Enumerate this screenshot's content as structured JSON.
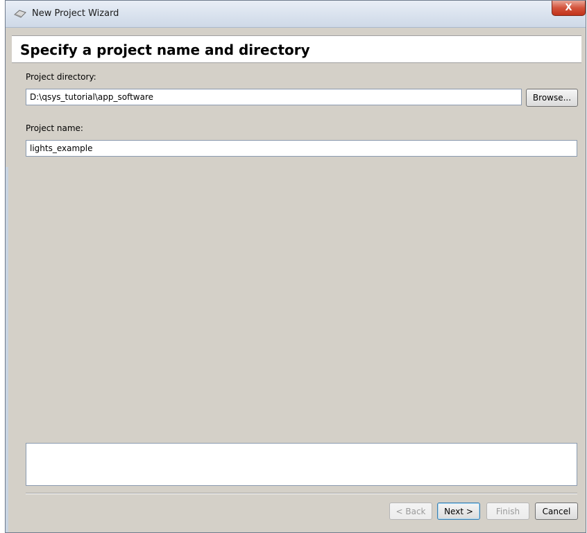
{
  "window": {
    "title": "New Project Wizard",
    "close_glyph": "X"
  },
  "header": {
    "title": "Specify a project name and directory"
  },
  "form": {
    "directory_label": "Project directory:",
    "directory_value": "D:\\qsys_tutorial\\app_software",
    "browse_label": "Browse...",
    "name_label": "Project name:",
    "name_value": "lights_example"
  },
  "message": {
    "text": ""
  },
  "footer": {
    "back_label": "< Back",
    "next_label": "Next >",
    "finish_label": "Finish",
    "cancel_label": "Cancel"
  },
  "icons": {
    "title_icon": "wizard-gem-icon"
  }
}
